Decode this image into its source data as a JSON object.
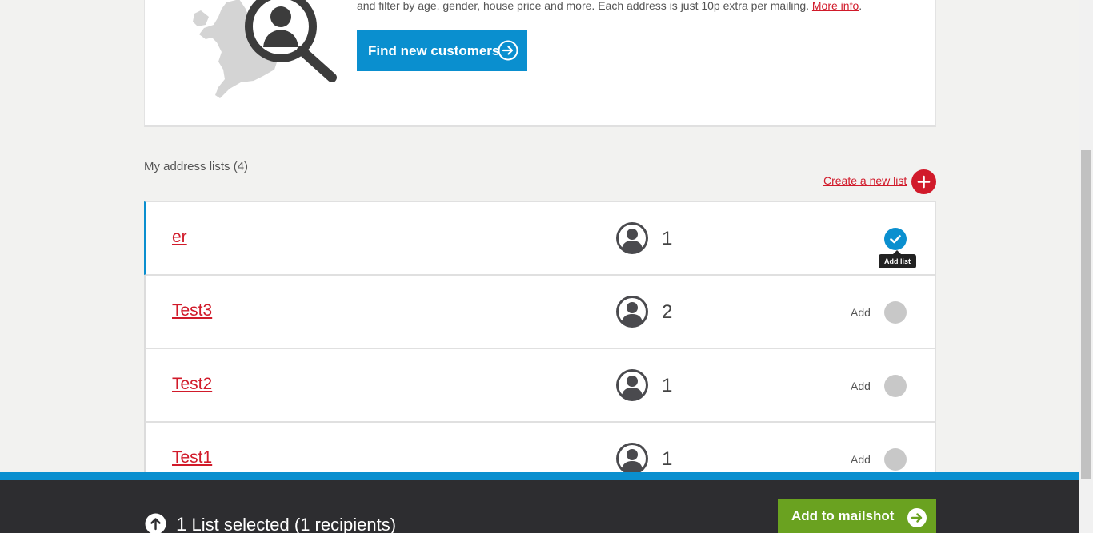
{
  "promo": {
    "text": "and filter by age, gender, house price and more. Each address is just 10p extra per mailing.",
    "more_info": "More info",
    "after": ".",
    "find_button": "Find new customers"
  },
  "lists": {
    "title": "My address lists (4)",
    "create_label": "Create a new list",
    "add_label": "Add",
    "tooltip": "Add list",
    "items": [
      {
        "name": "er",
        "count": "1",
        "selected": true
      },
      {
        "name": "Test3",
        "count": "2",
        "selected": false
      },
      {
        "name": "Test2",
        "count": "1",
        "selected": false
      },
      {
        "name": "Test1",
        "count": "1",
        "selected": false
      }
    ]
  },
  "footer": {
    "selected_count": "1",
    "summary": "List selected (1 recipients)",
    "mailshot_button": "Add to mailshot"
  },
  "colors": {
    "accent_blue": "#0a8fcf",
    "brand_red": "#d11a2a",
    "action_green": "#6aa220",
    "footer_dark": "#2d2d30"
  },
  "icons": {
    "map": "uk-map-magnifier-icon",
    "arrow": "arrow-right-circle-icon",
    "plus": "plus-icon",
    "user": "user-avatar-icon",
    "check": "check-icon",
    "up": "arrow-up-circle-icon"
  }
}
